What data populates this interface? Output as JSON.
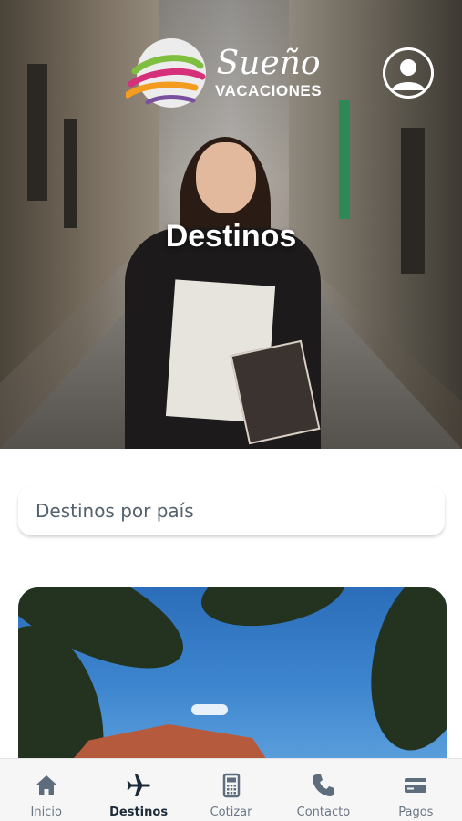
{
  "brand": {
    "name_script": "Sueño",
    "name_sub": "VACACIONES",
    "logo_colors": [
      "#7fbf3f",
      "#d6307a",
      "#f39c1f",
      "#7a4fa0",
      "#e9e9e9"
    ]
  },
  "header": {
    "profile_icon": "user-circle-icon"
  },
  "hero": {
    "title": "Destinos"
  },
  "filter": {
    "label": "Destinos por país"
  },
  "card": {
    "image": "tropical-destination-photo"
  },
  "bottom_nav": {
    "items": [
      {
        "label": "Inicio",
        "icon": "home-icon"
      },
      {
        "label": "Destinos",
        "icon": "airplane-icon",
        "active": true
      },
      {
        "label": "Cotizar",
        "icon": "calculator-icon"
      },
      {
        "label": "Contacto",
        "icon": "phone-icon"
      },
      {
        "label": "Pagos",
        "icon": "credit-card-icon"
      }
    ]
  },
  "colors": {
    "nav_active": "#1d2b38",
    "nav_inactive": "#6b7784",
    "filter_text": "#53606d"
  }
}
